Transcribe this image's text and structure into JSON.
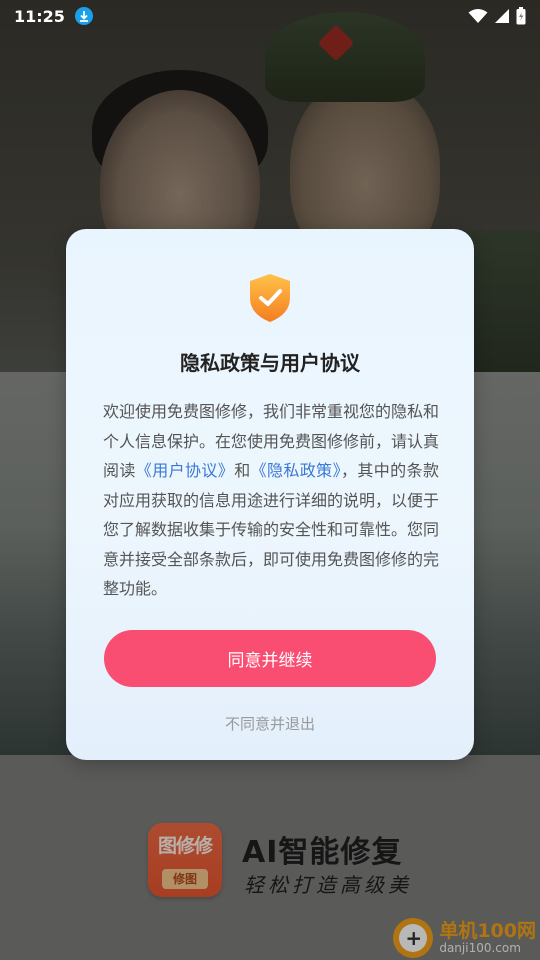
{
  "status_bar": {
    "time": "11:25",
    "icons": [
      "download-icon",
      "wifi-icon",
      "signal-icon",
      "battery-icon"
    ]
  },
  "dialog": {
    "title": "隐私政策与用户协议",
    "icon": "shield-check-icon",
    "body_part1": "欢迎使用免费图修修，我们非常重视您的隐私和个人信息保护。在您使用免费图修修前，请认真阅读",
    "link_user_agreement": "《用户协议》",
    "body_and": "和",
    "link_privacy_policy": "《隐私政策》",
    "body_part2": "，其中的条款对应用获取的信息用途进行详细的说明，以便于您了解数据收集于传输的安全性和可靠性。您同意并接受全部条款后，即可使用免费图修修的完整功能。",
    "agree_button": "同意并继续",
    "disagree_link": "不同意并退出"
  },
  "splash": {
    "logo_top": "图修修",
    "logo_bottom": "修图",
    "brand_title": "AI智能修复",
    "brand_subtitle": "轻松打造高级美"
  },
  "watermark": {
    "main": "单机100网",
    "url": "danji100.com"
  },
  "colors": {
    "accent": "#fa4d72",
    "link": "#3a78d8",
    "shield_orange": "#f5a623",
    "download_badge": "#1aa0e8"
  }
}
